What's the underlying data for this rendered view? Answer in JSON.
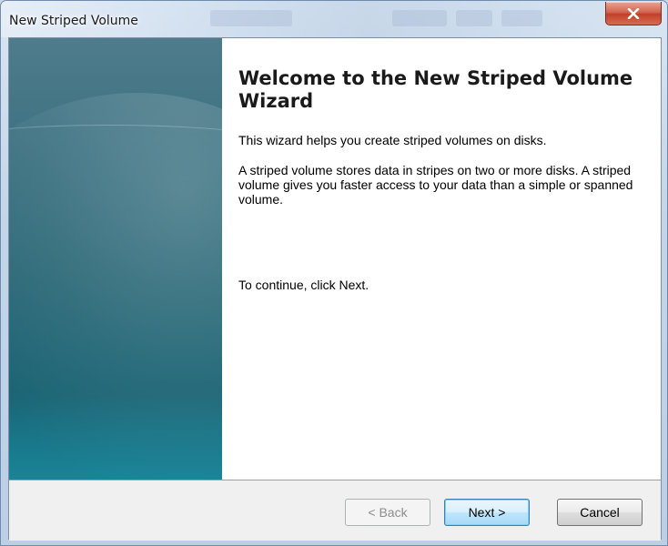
{
  "window": {
    "title": "New Striped Volume",
    "close_icon": "close-x-icon"
  },
  "wizard": {
    "heading": "Welcome to the New Striped Volume Wizard",
    "intro": "This wizard helps you create striped volumes on disks.",
    "description": "A striped volume stores data in stripes on two or more disks. A striped volume gives you faster access to your data than a simple or spanned volume.",
    "instruction": "To continue, click Next."
  },
  "buttons": {
    "back_label": "< Back",
    "back_enabled": false,
    "next_label": "Next >",
    "cancel_label": "Cancel"
  },
  "colors": {
    "close_button": "#c1402a",
    "panel_accent": "#2b6877",
    "default_button_border": "#3c7fb1"
  }
}
